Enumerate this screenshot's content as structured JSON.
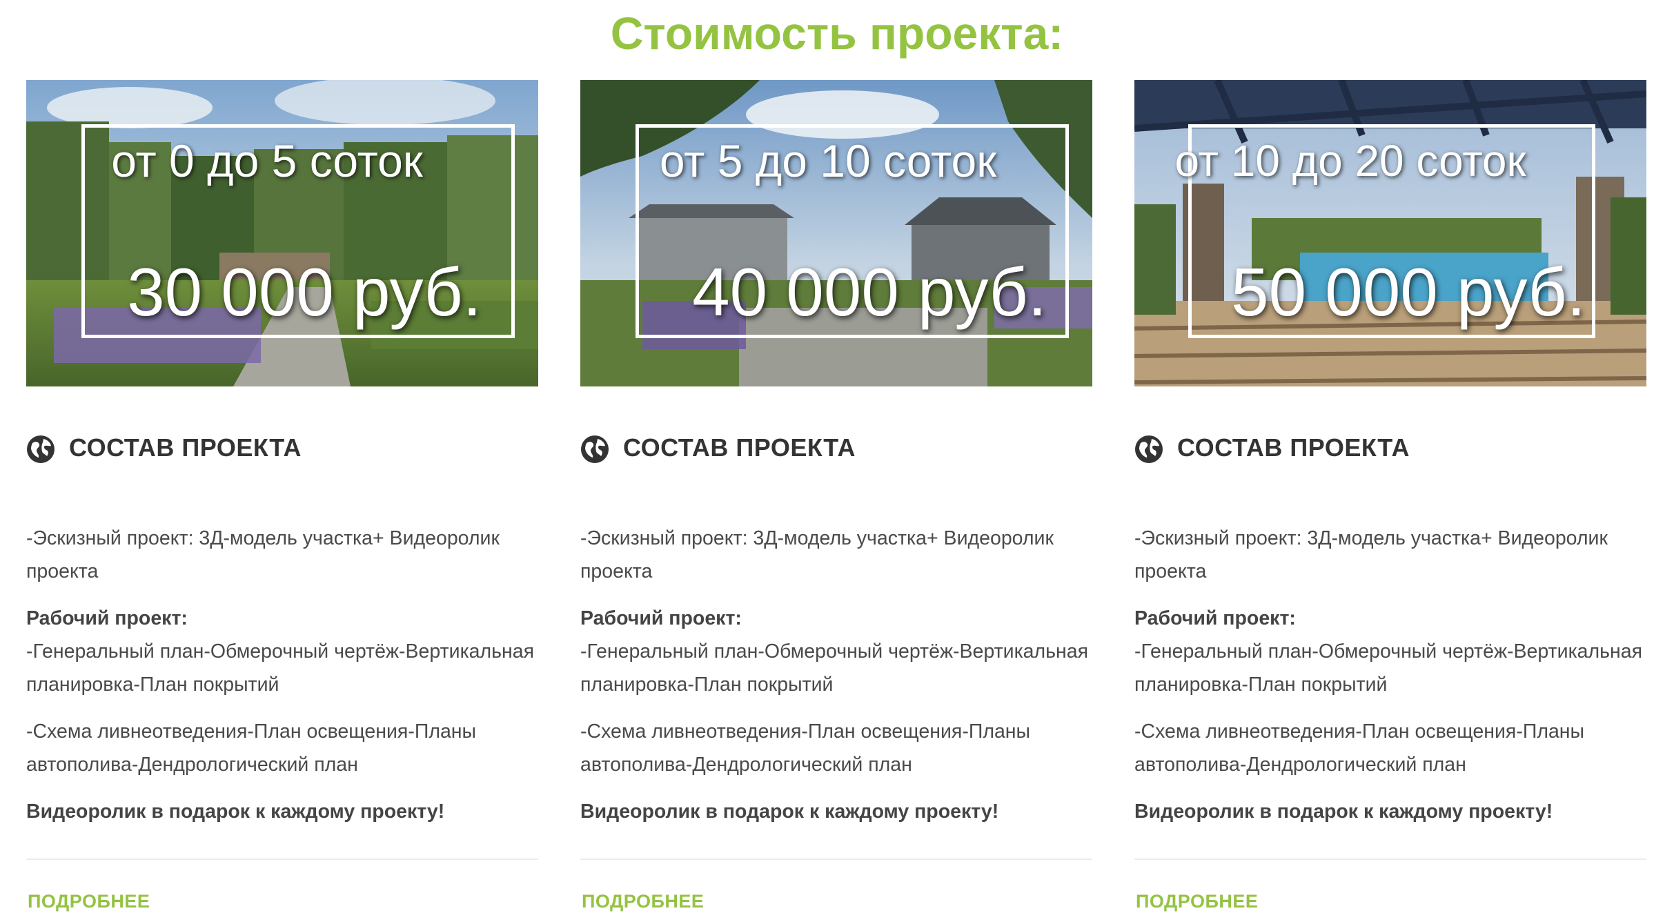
{
  "page": {
    "title": "Стоимость проекта:"
  },
  "colors": {
    "accent": "#94c341",
    "heading": "#333333",
    "text": "#4a4a4a",
    "divider": "#ececec"
  },
  "cards": [
    {
      "image": {
        "area": "от 0 до 5 соток",
        "price": "30 000 руб."
      },
      "section_icon": "globe-icon",
      "section_title": "СОСТАВ ПРОЕКТА",
      "sketch": "-Эскизный  проект: 3Д-модель участка+ Видеоролик проекта",
      "work_label": "Рабочий проект:",
      "work_line1": "-Генеральный план-Обмерочный чертёж-Вертикальная планировка-План покрытий",
      "work_line2": "-Схема ливнеотведения-План освещения-Планы автополива-Дендрологический план",
      "gift": "Видеоролик в подарок к каждому проекту!",
      "more_label": "ПОДРОБНЕЕ"
    },
    {
      "image": {
        "area": "от 5 до 10 соток",
        "price": "40 000 руб."
      },
      "section_icon": "globe-icon",
      "section_title": "СОСТАВ ПРОЕКТА",
      "sketch": "-Эскизный  проект: 3Д-модель участка+ Видеоролик проекта",
      "work_label": "Рабочий проект:",
      "work_line1": "-Генеральный план-Обмерочный чертёж-Вертикальная планировка-План покрытий",
      "work_line2": "-Схема ливнеотведения-План освещения-Планы автополива-Дендрологический план",
      "gift": "Видеоролик в подарок к каждому проекту!",
      "more_label": "ПОДРОБНЕЕ"
    },
    {
      "image": {
        "area": "от 10 до 20 соток",
        "price": "50 000 руб."
      },
      "section_icon": "globe-icon",
      "section_title": "СОСТАВ ПРОЕКТА",
      "sketch": "-Эскизный  проект: 3Д-модель участка+ Видеоролик проекта",
      "work_label": "Рабочий проект:",
      "work_line1": "-Генеральный план-Обмерочный чертёж-Вертикальная планировка-План покрытий",
      "work_line2": "-Схема ливнеотведения-План освещения-Планы автополива-Дендрологический план",
      "gift": "Видеоролик в подарок к каждому проекту!",
      "more_label": "ПОДРОБНЕЕ"
    }
  ]
}
